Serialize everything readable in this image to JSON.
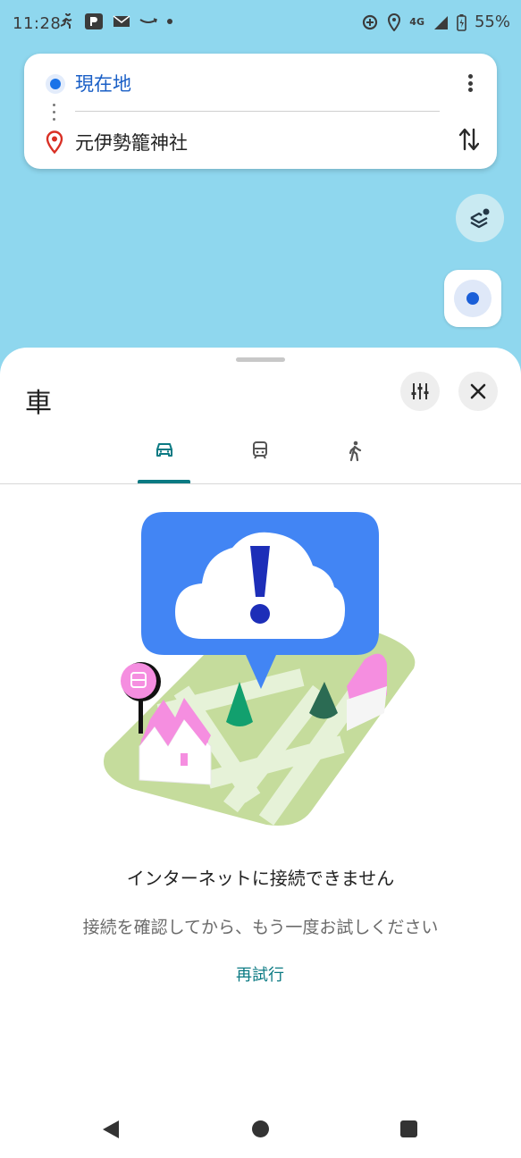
{
  "status_bar": {
    "time": "11:28",
    "network": "4G",
    "battery": "55%"
  },
  "route": {
    "origin": "現在地",
    "destination": "元伊勢籠神社"
  },
  "sheet": {
    "title": "車",
    "tabs": [
      {
        "icon": "car-icon",
        "selected": true
      },
      {
        "icon": "transit-icon",
        "selected": false
      },
      {
        "icon": "walk-icon",
        "selected": false
      }
    ]
  },
  "error": {
    "title": "インターネットに接続できません",
    "message": "接続を確認してから、もう一度お試しください",
    "retry_label": "再試行"
  },
  "colors": {
    "map_water": "#8fd7ee",
    "accent": "#0b7a83",
    "origin_blue": "#1a73e8",
    "pin_red": "#d93025",
    "bubble_blue": "#4285f4"
  }
}
